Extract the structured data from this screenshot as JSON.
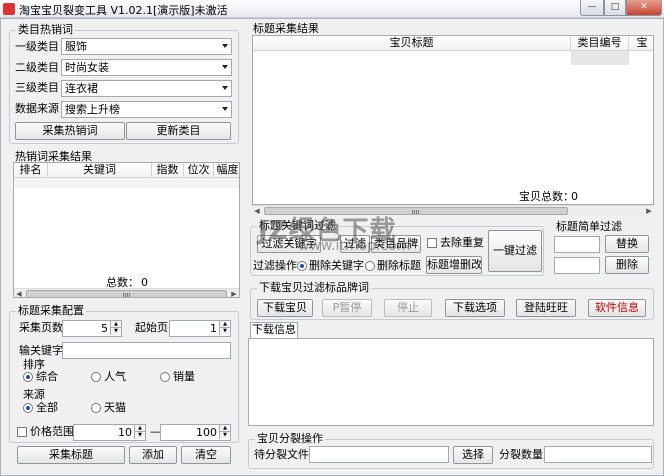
{
  "window": {
    "title": "淘宝宝贝裂变工具 V1.02.1[演示版]未激活",
    "minimize": "—",
    "maximize": "□",
    "close": "✕"
  },
  "category": {
    "title": "类目热销词",
    "level1_label": "一级类目",
    "level1_value": "服饰",
    "level2_label": "二级类目",
    "level2_value": "时尚女装",
    "level3_label": "三级类目",
    "level3_value": "连衣裙",
    "source_label": "数据来源",
    "source_value": "搜索上升榜",
    "collect_button": "采集热销词",
    "update_button": "更新类目"
  },
  "hotwords": {
    "title": "热销词采集结果",
    "columns": [
      "排名",
      "关键词",
      "指数",
      "位次",
      "幅度"
    ],
    "total_label": "总数：",
    "total_value": "0"
  },
  "config": {
    "title": "标题采集配置",
    "pages_label": "采集页数",
    "pages_value": "5",
    "start_label": "起始页",
    "start_value": "1",
    "keyword_label": "输关键字",
    "keyword_value": "",
    "sort_label": "排序",
    "sort_options": [
      "综合",
      "人气",
      "销量"
    ],
    "source_label": "来源",
    "source_options": [
      "全部",
      "天猫"
    ],
    "price_label": "价格范围",
    "price_min": "10",
    "price_sep": "—",
    "price_max": "100",
    "collect_button": "采集标题",
    "add_button": "添加",
    "clear_button": "清空"
  },
  "results": {
    "title": "标题采集结果",
    "columns": [
      "宝贝标题",
      "类目编号",
      "宝"
    ],
    "total_label": "宝贝总数：",
    "total_value": "0"
  },
  "filter": {
    "title": "标题关键词过滤",
    "buttons": [
      "过滤关键字",
      "过滤",
      "类目品牌"
    ],
    "dedupe_label": "去除重复",
    "mode_label": "过滤操作",
    "mode_options": [
      "删除关键字",
      "删除标题"
    ],
    "edit_button": "标题增删改",
    "one_click_button": "一键过滤"
  },
  "simple_filter": {
    "title": "标题简单过滤",
    "replace_button": "替换",
    "delete_button": "删除"
  },
  "download": {
    "title": "下载宝贝过滤标品牌词",
    "download_button": "下载宝贝",
    "pause_button": "P暂停",
    "stop_button": "停止",
    "options_button": "下载选项",
    "login_button": "登陆旺旺",
    "info_button": "软件信息",
    "tab_label": "下载信息"
  },
  "split": {
    "title": "宝贝分裂操作",
    "file_label": "待分裂文件",
    "select_button": "选择",
    "count_label": "分裂数量"
  },
  "watermark": {
    "main": "JZ绿色下载",
    "sub": "www.itmop.com"
  }
}
